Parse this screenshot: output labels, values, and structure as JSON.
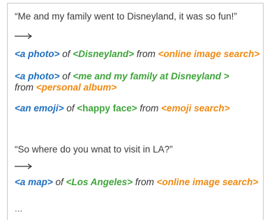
{
  "quote1": "“Me and my family went to Disneyland, it was so fun!”",
  "quote2": "“So where do you wnat to visit in LA?”",
  "of": "of",
  "from": "from",
  "line1": {
    "type": "<a photo>",
    "entity": "<Disneyland>",
    "source": "<online image search>"
  },
  "line2": {
    "type": "<a photo>",
    "entity": "<me and my family at Disneyland >",
    "source": "<personal album>"
  },
  "line3": {
    "type": "<an emoji>",
    "entity": "<happy face>",
    "source": "<emoji search>"
  },
  "line4": {
    "type": "<a map>",
    "entity": "<Los Angeles>",
    "source": "<online image search>"
  },
  "ellipsis": "...",
  "colors": {
    "type": "#1f6fbf",
    "entity": "#3ea43a",
    "source": "#ee8a12"
  }
}
